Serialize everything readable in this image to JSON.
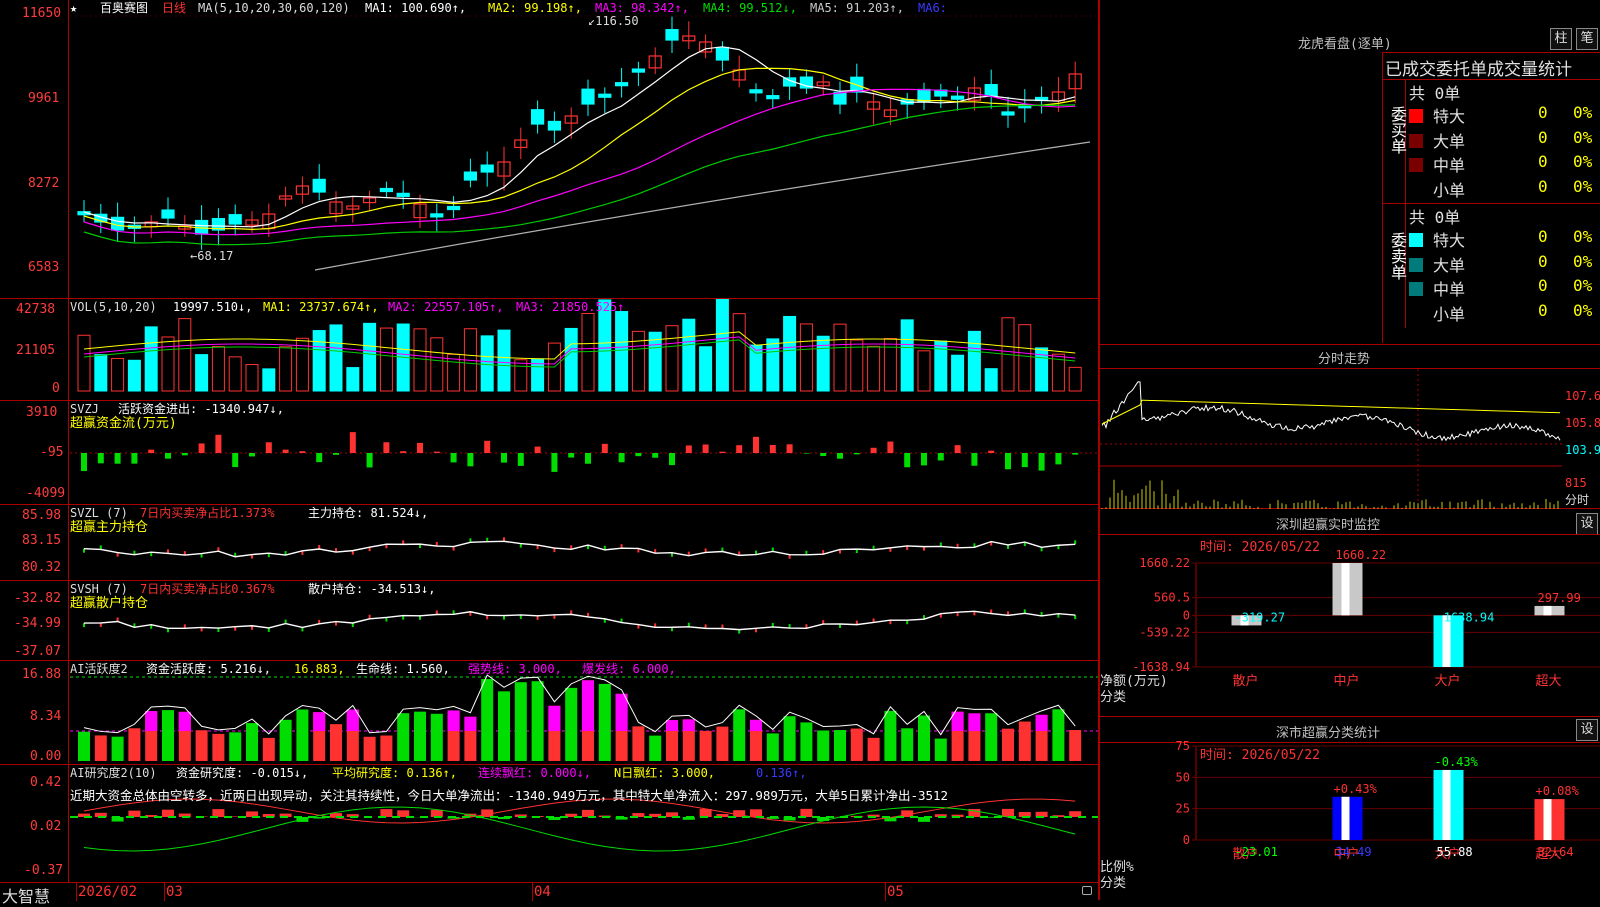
{
  "colors": {
    "up": "#ff3232",
    "down": "#00ffff",
    "ma1": "#ffffff",
    "ma2": "#ffff00",
    "ma3": "#ff00ff",
    "ma4": "#00cc00",
    "ma5": "#b0b0b0",
    "grid": "#aa0000",
    "green": "#00dd00"
  },
  "main": {
    "star": "★",
    "stock_name": "百奥赛图",
    "period": "日线",
    "ma_params": "MA(5,10,20,30,60,120)",
    "ma1": "MA1: 100.690↑,",
    "ma2": "MA2: 99.198↑,",
    "ma3": "MA3: 98.342↑,",
    "ma4": "MA4: 99.512↓,",
    "ma5": "MA5: 91.203↑,",
    "ma6": "MA6:",
    "y_labels": [
      "11650",
      "9961",
      "8272",
      "6583"
    ],
    "high_mark": "116.50",
    "low_mark": "68.17"
  },
  "vol": {
    "title": "VOL(5,10,20)",
    "val": "19997.510↓,",
    "ma1": "MA1: 23737.674↑,",
    "ma2": "MA2: 22557.105↑,",
    "ma3": "MA3: 21850.525↑",
    "y_labels": [
      "42738",
      "21105",
      "0"
    ]
  },
  "svzj": {
    "title": "SVZJ",
    "label": "活跃资金进出: -1340.947↓,",
    "sub": "超赢资金流(万元)",
    "y_labels": [
      "3910",
      "-95",
      "-4099"
    ]
  },
  "svzl": {
    "title": "SVZL (7)",
    "ratio": "7日内买卖净占比1.373%",
    "hold": "主力持仓: 81.524↓,",
    "sub": "超赢主力持仓",
    "y_labels": [
      "85.98",
      "83.15",
      "80.32"
    ]
  },
  "svsh": {
    "title": "SVSH (7)",
    "ratio": "7日内买卖净占比0.367%",
    "hold": "散户持仓: -34.513↓,",
    "sub": "超赢散户持仓",
    "y_labels": [
      "-32.82",
      "-34.99",
      "-37.07"
    ]
  },
  "ai2": {
    "title": "AI活跃度2",
    "a": "资金活跃度: 5.216↓,",
    "b": "16.883,",
    "c": "生命线: 1.560,",
    "d": "强势线: 3.000,",
    "e": "爆发线: 6.000,",
    "y_labels": [
      "16.88",
      "8.34",
      "0.00"
    ]
  },
  "ai3": {
    "title": "AI研究度2(10)",
    "a": "资金研究度: -0.015↓,",
    "b": "平均研究度: 0.136↑,",
    "c": "连续飘红: 0.000↓,",
    "d": "N日飘红: 3.000,",
    "e": "0.136↑,",
    "note": "近期大资金总体由空转多，近两日出现异动，关注其持续性，今日大单净流出：-1340.949万元，其中特大单净流入：297.989万元，大单5日累计净出-3512",
    "y_labels": [
      "0.42",
      "0.02",
      "-0.37"
    ]
  },
  "bottom": {
    "brand": "大智慧",
    "dates": [
      "2026/02",
      "03",
      "04",
      "05"
    ]
  },
  "lhkp": {
    "title": "龙虎看盘(逐单)",
    "btn1": "柱",
    "btn2": "笔",
    "head": "已成交委托单成交量统计",
    "buy_label": "委买单",
    "sell_label": "委卖单",
    "buy_total": "共 0单",
    "sell_total": "共 0单",
    "buy_rows": [
      {
        "name": "特大",
        "val": "0",
        "pct": "0%"
      },
      {
        "name": "大单",
        "val": "0",
        "pct": "0%"
      },
      {
        "name": "中单",
        "val": "0",
        "pct": "0%"
      },
      {
        "name": "小单",
        "val": "0",
        "pct": "0%"
      }
    ],
    "sell_rows": [
      {
        "name": "特大",
        "val": "0",
        "pct": "0%"
      },
      {
        "name": "大单",
        "val": "0",
        "pct": "0%"
      },
      {
        "name": "中单",
        "val": "0",
        "pct": "0%"
      },
      {
        "name": "小单",
        "val": "0",
        "pct": "0%"
      }
    ]
  },
  "fenshi": {
    "title": "分时走势",
    "y": [
      "107.6",
      "105.8",
      "103.9",
      "815"
    ],
    "unit": "分时"
  },
  "sz1": {
    "title": "深圳超赢实时监控",
    "btn": "设",
    "time": "时间: 2026/05/22",
    "ylabel": "净额(万元)",
    "xlabel": "分类",
    "y_labels": [
      "1660.22",
      "560.5",
      "0",
      "-539.22",
      "-1638.94"
    ],
    "cats": [
      "散户",
      "中户",
      "大户",
      "超大"
    ],
    "values": [
      "-319.27",
      "1660.22",
      "-1638.94",
      "297.99"
    ]
  },
  "sz2": {
    "title": "深市超赢分类统计",
    "btn": "设",
    "time": "时间: 2026/05/22",
    "ylabel": "比例%",
    "xlabel": "分类",
    "y_labels": [
      "75",
      "50",
      "25",
      "0"
    ],
    "cats": [
      "散户",
      "中户",
      "大户",
      "超大"
    ],
    "values": [
      "-23.01",
      "34.49",
      "55.88",
      "32.64"
    ],
    "changes": [
      "",
      "+0.43%",
      "-0.43%",
      "+0.08%"
    ]
  },
  "chart_data": [
    {
      "type": "bar",
      "title": "深圳超赢实时监控",
      "xlabel": "分类",
      "ylabel": "净额(万元)",
      "categories": [
        "散户",
        "中户",
        "大户",
        "超大"
      ],
      "values": [
        -319.27,
        1660.22,
        -1638.94,
        297.99
      ],
      "ylim": [
        -1638.94,
        1660.22
      ]
    },
    {
      "type": "bar",
      "title": "深市超赢分类统计",
      "xlabel": "分类",
      "ylabel": "比例%",
      "categories": [
        "散户",
        "中户",
        "大户",
        "超大"
      ],
      "values": [
        0,
        34.49,
        55.88,
        32.64
      ],
      "ylim": [
        0,
        75
      ]
    }
  ]
}
